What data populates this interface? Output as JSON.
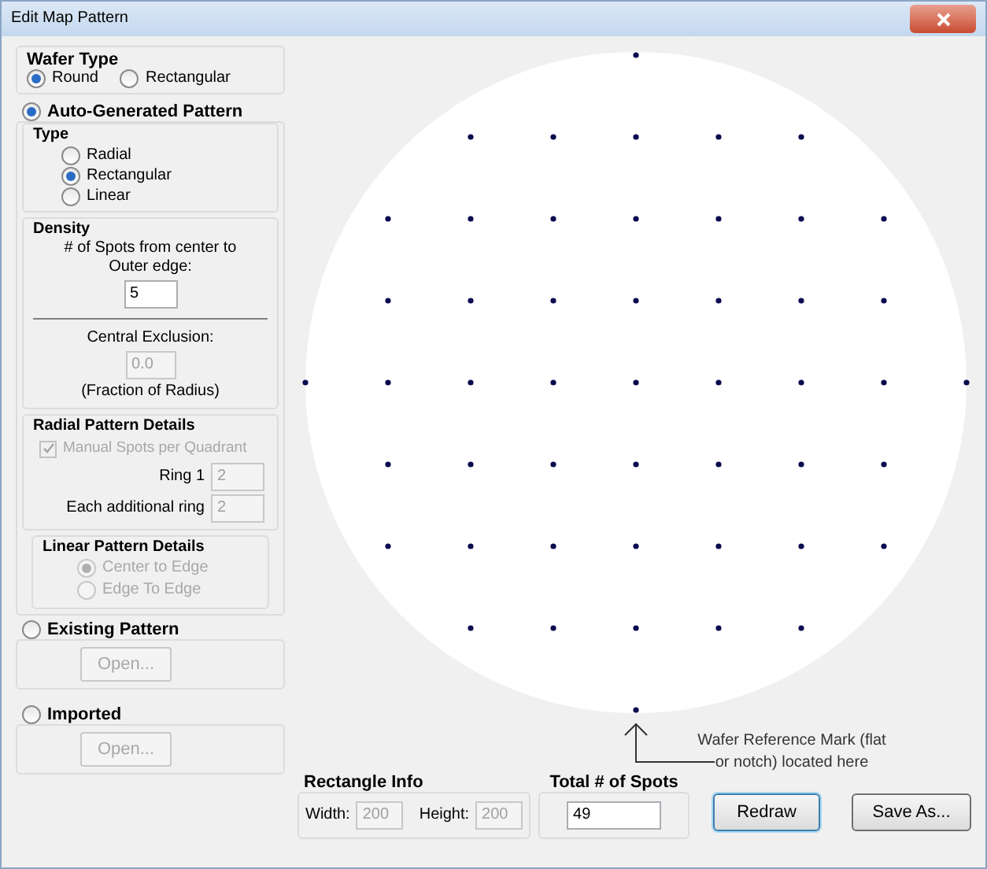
{
  "window": {
    "title": "Edit Map Pattern"
  },
  "wafer_type": {
    "title": "Wafer Type",
    "options": [
      {
        "label": "Round",
        "selected": true
      },
      {
        "label": "Rectangular",
        "selected": false
      }
    ]
  },
  "auto_pattern": {
    "label": "Auto-Generated Pattern",
    "selected": true,
    "type": {
      "title": "Type",
      "options": [
        {
          "label": "Radial",
          "selected": false
        },
        {
          "label": "Rectangular",
          "selected": true
        },
        {
          "label": "Linear",
          "selected": false
        }
      ]
    },
    "density": {
      "title": "Density",
      "spots_label": "# of Spots from center to Outer edge:",
      "spots_value": "5",
      "exclusion_label": "Central Exclusion:",
      "exclusion_value": "0.0",
      "exclusion_note": "(Fraction of Radius)",
      "exclusion_disabled": true
    },
    "radial": {
      "title": "Radial Pattern Details",
      "disabled": true,
      "manual_label": "Manual Spots per Quadrant",
      "manual_checked": true,
      "ring1_label": "Ring 1",
      "ring1_value": "2",
      "additional_label": "Each additional ring",
      "additional_value": "2"
    },
    "linear": {
      "title": "Linear Pattern Details",
      "disabled": true,
      "options": [
        {
          "label": "Center to Edge",
          "selected": true
        },
        {
          "label": "Edge To Edge",
          "selected": false
        }
      ]
    }
  },
  "existing_pattern": {
    "label": "Existing Pattern",
    "selected": false,
    "button": "Open...",
    "disabled": true
  },
  "imported": {
    "label": "Imported",
    "selected": false,
    "button": "Open...",
    "disabled": true
  },
  "reference_note": "Wafer Reference Mark (flat or notch) located here",
  "rectangle_info": {
    "title": "Rectangle Info",
    "width_label": "Width:",
    "width_value": "200",
    "height_label": "Height:",
    "height_value": "200",
    "disabled": true
  },
  "total_spots": {
    "title": "Total # of Spots",
    "value": "49"
  },
  "buttons": [
    {
      "label": "Redraw",
      "focused": true
    },
    {
      "label": "Save As...",
      "focused": false
    }
  ]
}
